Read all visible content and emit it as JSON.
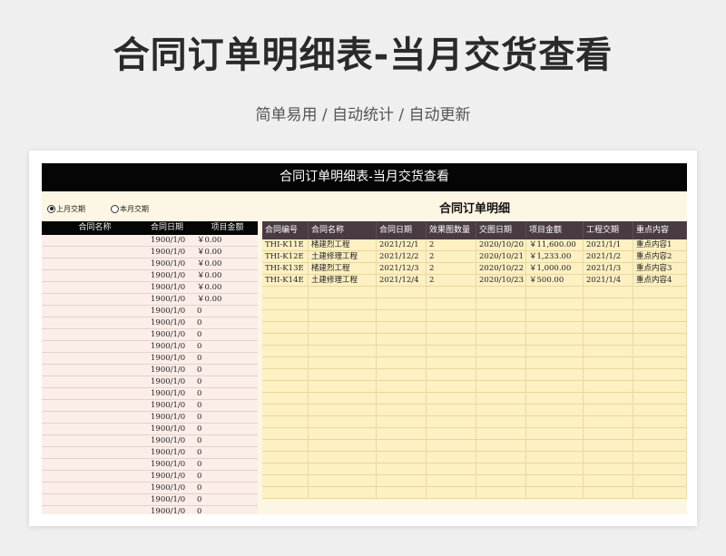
{
  "header": {
    "title": "合同订单明细表-当月交货查看",
    "subtitle": "简单易用 / 自动统计 / 自动更新"
  },
  "sheet": {
    "banner_title": "合同订单明细表-当月交货查看",
    "radio_options": [
      {
        "label": "上月交期",
        "checked": true
      },
      {
        "label": "本月交期",
        "checked": false
      }
    ],
    "detail_title": "合同订单明细",
    "left_table": {
      "headers": [
        "合同名称",
        "合同日期",
        "项目金额"
      ],
      "rows": [
        [
          "",
          "1900/1/0",
          "￥0.00"
        ],
        [
          "",
          "1900/1/0",
          "￥0.00"
        ],
        [
          "",
          "1900/1/0",
          "￥0.00"
        ],
        [
          "",
          "1900/1/0",
          "￥0.00"
        ],
        [
          "",
          "1900/1/0",
          "￥0.00"
        ],
        [
          "",
          "1900/1/0",
          "￥0.00"
        ],
        [
          "",
          "1900/1/0",
          "0"
        ],
        [
          "",
          "1900/1/0",
          "0"
        ],
        [
          "",
          "1900/1/0",
          "0"
        ],
        [
          "",
          "1900/1/0",
          "0"
        ],
        [
          "",
          "1900/1/0",
          "0"
        ],
        [
          "",
          "1900/1/0",
          "0"
        ],
        [
          "",
          "1900/1/0",
          "0"
        ],
        [
          "",
          "1900/1/0",
          "0"
        ],
        [
          "",
          "1900/1/0",
          "0"
        ],
        [
          "",
          "1900/1/0",
          "0"
        ],
        [
          "",
          "1900/1/0",
          "0"
        ],
        [
          "",
          "1900/1/0",
          "0"
        ],
        [
          "",
          "1900/1/0",
          "0"
        ],
        [
          "",
          "1900/1/0",
          "0"
        ],
        [
          "",
          "1900/1/0",
          "0"
        ],
        [
          "",
          "1900/1/0",
          "0"
        ],
        [
          "",
          "1900/1/0",
          "0"
        ],
        [
          "",
          "1900/1/0",
          "0"
        ]
      ]
    },
    "right_table": {
      "headers": [
        "合同编号",
        "合同名称",
        "合同日期",
        "效果图数量",
        "交图日期",
        "项目金额",
        "工程交期",
        "重点内容"
      ],
      "rows": [
        [
          "THI-K11E",
          "楮建烈工程",
          "2021/12/1",
          "2",
          "2020/10/20",
          "￥11,600.00",
          "2021/1/1",
          "重点内容1"
        ],
        [
          "THI-K12E",
          "土建修理工程",
          "2021/12/2",
          "2",
          "2020/10/21",
          "￥1,233.00",
          "2021/1/2",
          "重点内容2"
        ],
        [
          "THI-K13E",
          "楮建烈工程",
          "2021/12/3",
          "2",
          "2020/10/22",
          "￥1,000.00",
          "2021/1/3",
          "重点内容3"
        ],
        [
          "THI-K14E",
          "土建修理工程",
          "2021/12/4",
          "2",
          "2020/10/23",
          "￥500.00",
          "2021/1/4",
          "重点内容4"
        ]
      ],
      "empty_row_count": 18
    }
  }
}
